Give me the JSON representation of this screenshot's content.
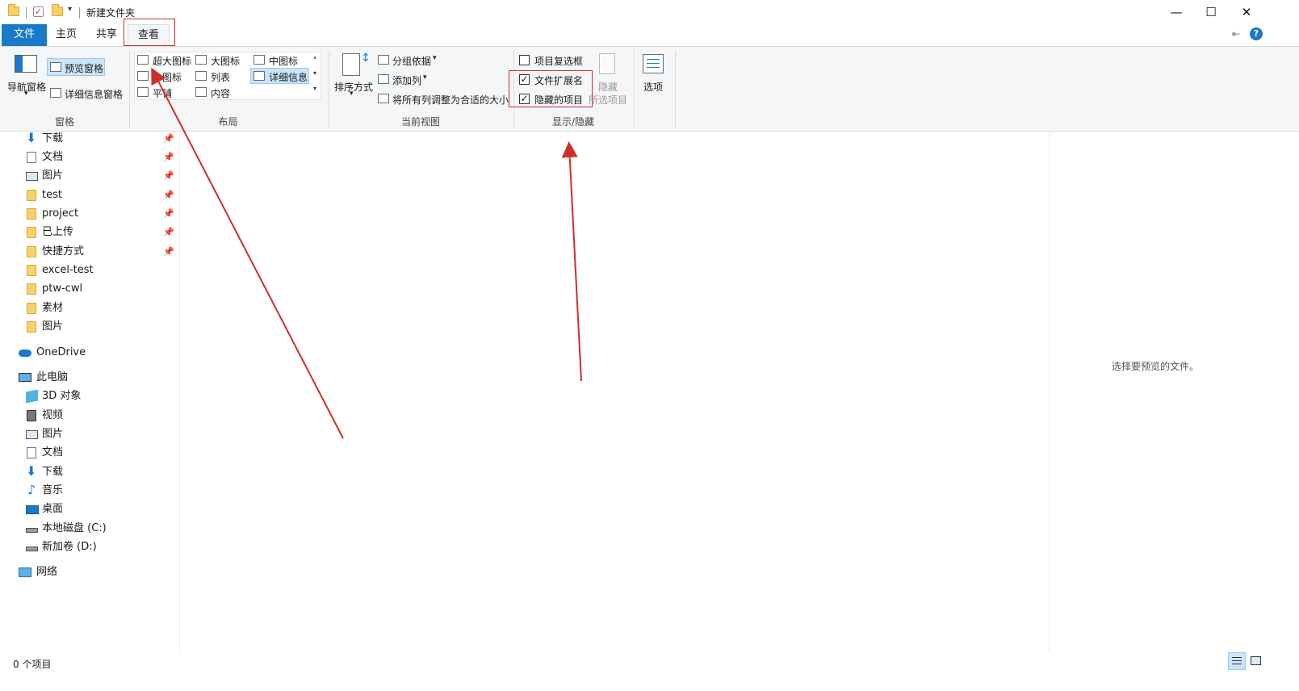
{
  "window": {
    "title": "新建文件夹",
    "controls": {
      "minimize": "—",
      "maximize": "☐",
      "close": "✕"
    }
  },
  "tabs": [
    {
      "label": "文件"
    },
    {
      "label": "主页"
    },
    {
      "label": "共享"
    },
    {
      "label": "查看"
    }
  ],
  "help": {
    "icon": "?",
    "collapse_icon": "⇤"
  },
  "ribbon": {
    "panes": {
      "label": "窗格",
      "nav_pane": "导航窗格",
      "preview_pane": "预览窗格",
      "details_pane": "详细信息窗格"
    },
    "layout": {
      "label": "布局",
      "options": [
        "超大图标",
        "大图标",
        "中图标",
        "小图标",
        "列表",
        "详细信息",
        "平铺",
        "内容"
      ],
      "selected": "详细信息"
    },
    "current_view": {
      "label": "当前视图",
      "sort": "排序方式",
      "group_by": "分组依据",
      "add_column": "添加列",
      "fit_columns": "将所有列调整为合适的大小"
    },
    "show_hide": {
      "label": "显示/隐藏",
      "item_checkboxes": {
        "label": "项目复选框",
        "checked": false
      },
      "file_extensions": {
        "label": "文件扩展名",
        "checked": true
      },
      "hidden_items": {
        "label": "隐藏的项目",
        "checked": true
      },
      "hide_selected_line1": "隐藏",
      "hide_selected_line2": "所选项目"
    },
    "options": {
      "label": "选项"
    }
  },
  "nav": {
    "quick_access": [
      {
        "label": "下载",
        "pinned": true
      },
      {
        "label": "文档",
        "pinned": true
      },
      {
        "label": "图片",
        "pinned": true
      },
      {
        "label": "test",
        "pinned": true
      },
      {
        "label": "project",
        "pinned": true
      },
      {
        "label": "已上传",
        "pinned": true
      },
      {
        "label": "快捷方式",
        "pinned": true
      },
      {
        "label": "excel-test",
        "pinned": false
      },
      {
        "label": "ptw-cwl",
        "pinned": false
      },
      {
        "label": "素材",
        "pinned": false
      },
      {
        "label": "图片",
        "pinned": false
      }
    ],
    "onedrive": "OneDrive",
    "this_pc": "此电脑",
    "pc_items": [
      "3D 对象",
      "视频",
      "图片",
      "文档",
      "下载",
      "音乐",
      "桌面",
      "本地磁盘 (C:)",
      "新加卷 (D:)"
    ],
    "network": "网络"
  },
  "preview": {
    "empty_text": "选择要预览的文件。"
  },
  "status": {
    "item_count": "0 个项目"
  },
  "colors": {
    "accent": "#1979ca",
    "annotation_red": "#d12d2d",
    "selected_bg": "#cce4f7"
  }
}
